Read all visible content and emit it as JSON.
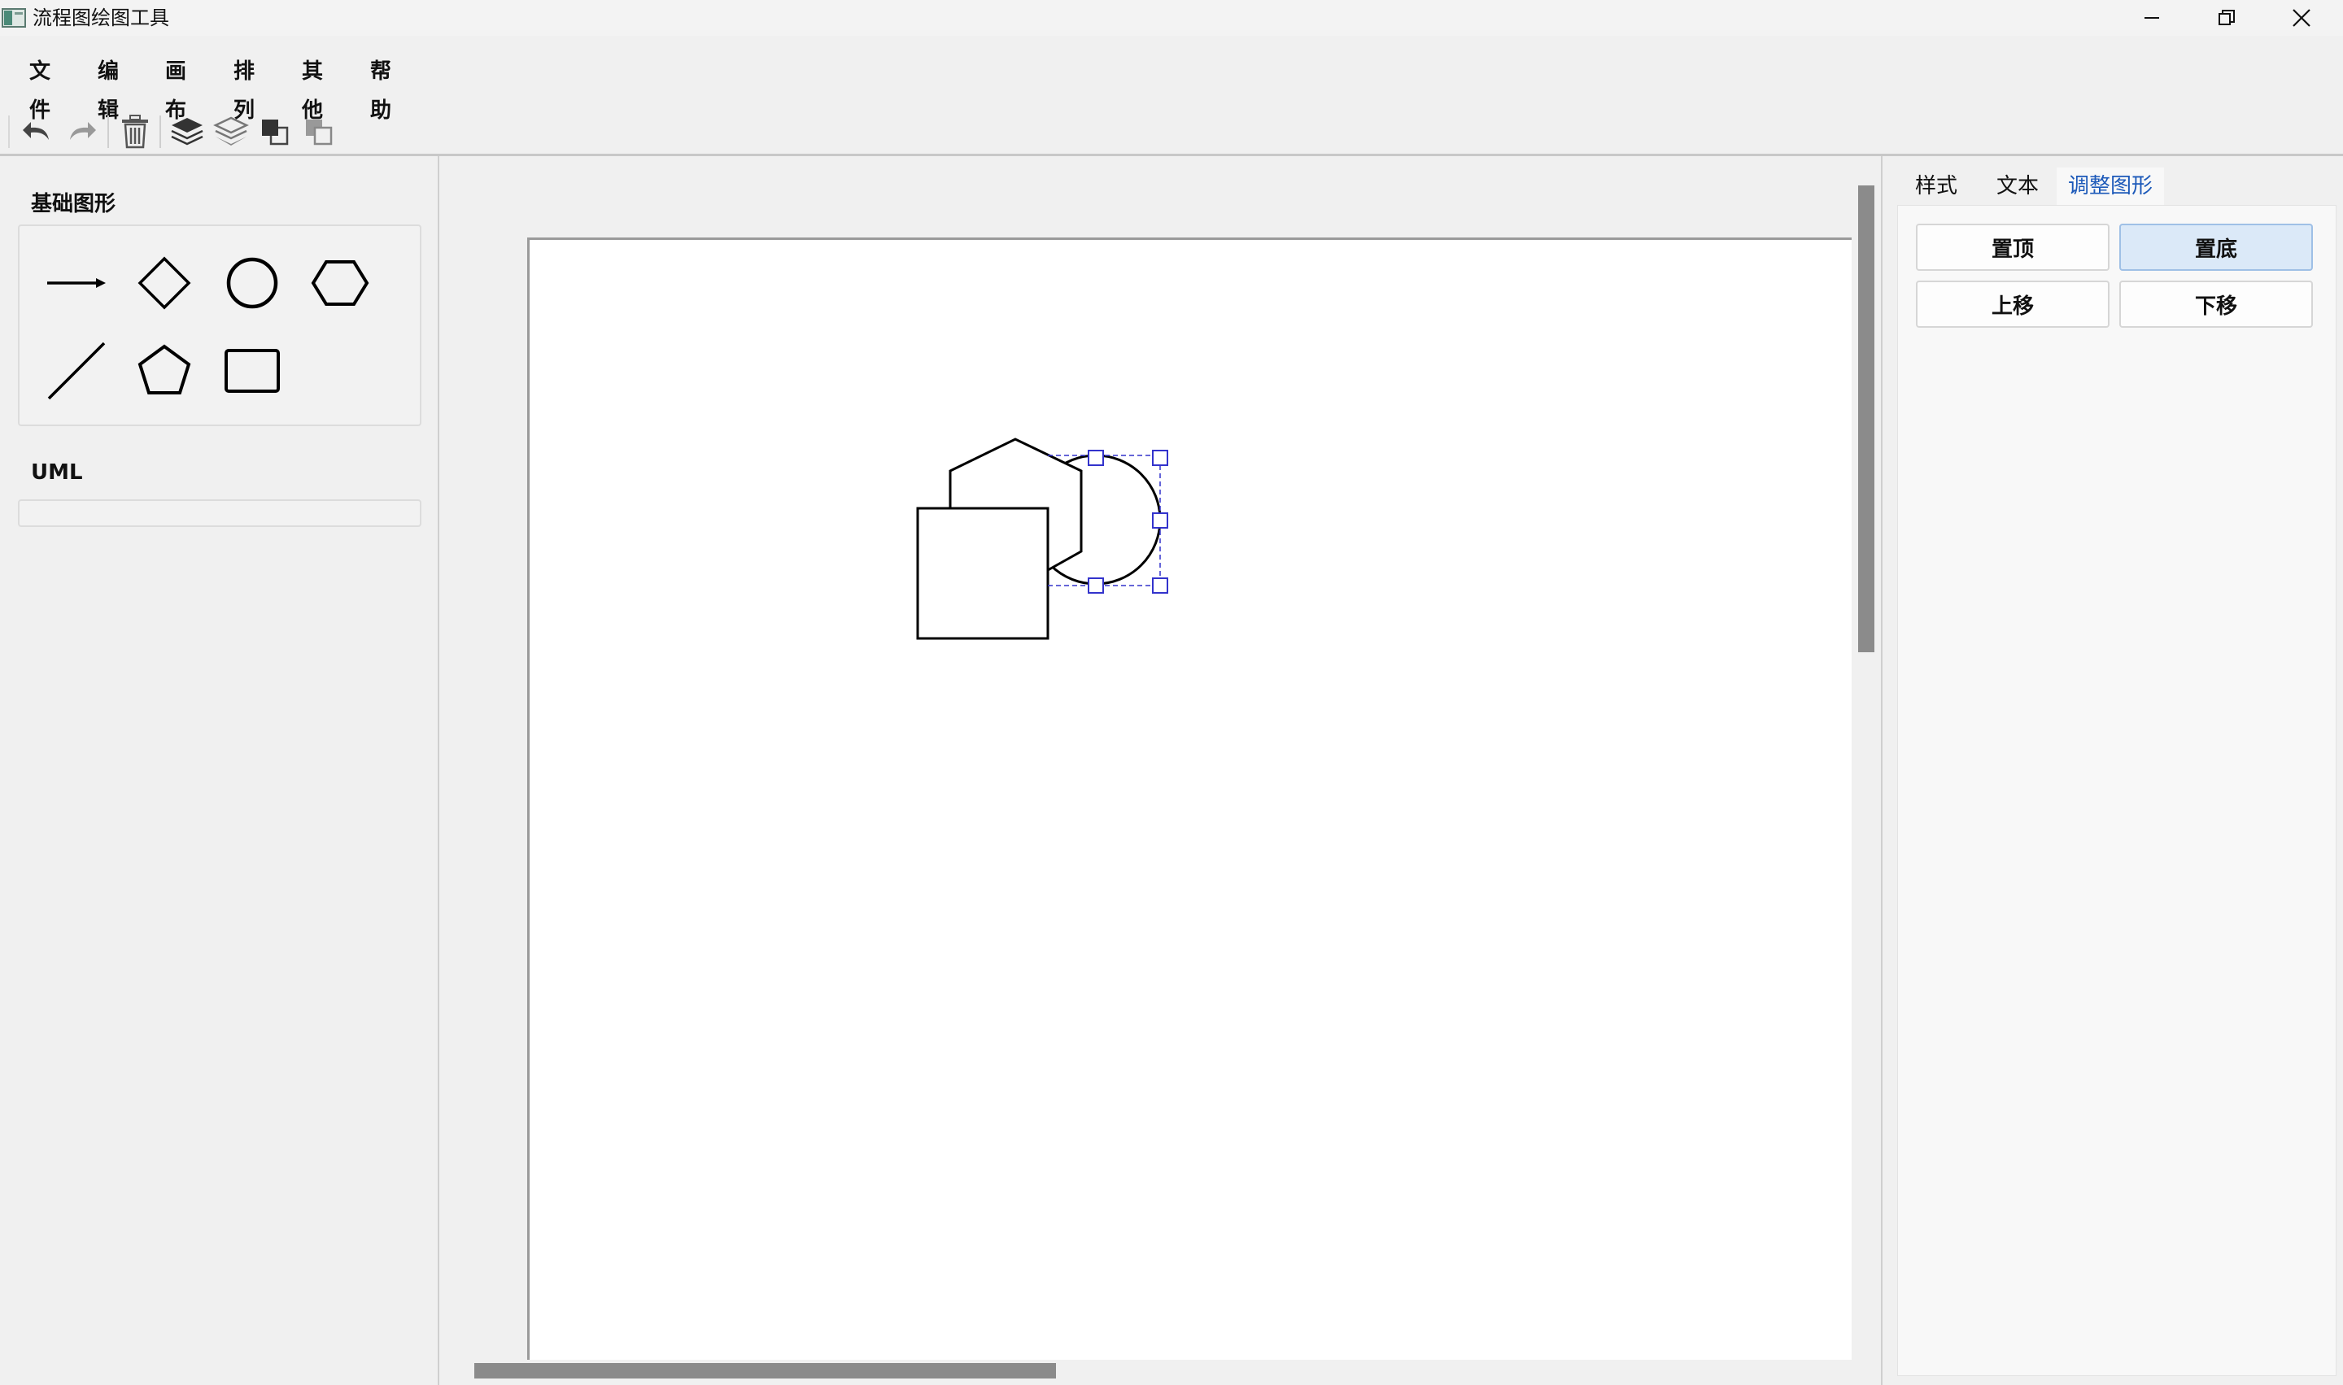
{
  "window": {
    "title": "流程图绘图工具",
    "controls": [
      "minimize-icon",
      "restore-icon",
      "close-icon"
    ]
  },
  "menu": {
    "items": [
      {
        "label": "文件"
      },
      {
        "label": "编辑"
      },
      {
        "label": "画布"
      },
      {
        "label": "排列"
      },
      {
        "label": "其他"
      },
      {
        "label": "帮助"
      }
    ]
  },
  "toolbar": {
    "tools": [
      "undo-icon",
      "redo-icon",
      "delete-icon",
      "layer-up-icon",
      "layer-down-icon",
      "bring-front-icon",
      "send-back-icon"
    ]
  },
  "left_panel": {
    "basic_shapes_title": "基础图形",
    "basic_shapes": [
      "arrow-icon",
      "diamond-icon",
      "circle-icon",
      "hexagon-icon",
      "line-icon",
      "pentagon-icon",
      "rectangle-icon"
    ],
    "uml_title": "UML"
  },
  "right_panel": {
    "tabs": [
      {
        "label": "样式",
        "active": false
      },
      {
        "label": "文本",
        "active": false
      },
      {
        "label": "调整图形",
        "active": true
      }
    ],
    "buttons": [
      {
        "label": "置顶",
        "pressed": false
      },
      {
        "label": "置底",
        "pressed": true
      },
      {
        "label": "上移",
        "pressed": false
      },
      {
        "label": "下移",
        "pressed": false
      }
    ]
  },
  "canvas": {
    "shapes": [
      "hexagon",
      "circle (selected)",
      "square"
    ],
    "selection_color": "#3333cc"
  },
  "colors": {
    "accent": "#1c59b9",
    "pressed_button": "#dbe9f8",
    "scrollbar": "#8b8b8b"
  }
}
